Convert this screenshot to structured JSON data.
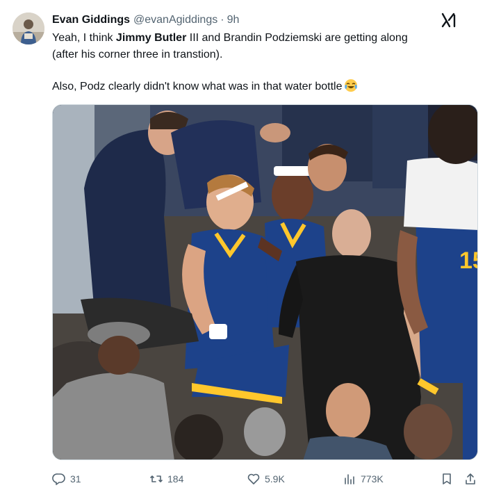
{
  "author": {
    "name": "Evan Giddings",
    "handle": "@evanAgiddings",
    "separator": "·",
    "time": "9h"
  },
  "tweet": {
    "line1_pre": "Yeah, I think ",
    "line1_bold": "Jimmy Butler",
    "line1_post": " III and Brandin Podziemski are getting along",
    "line2": "(after his corner three in transtion).",
    "line3": "Also, Podz clearly didn't know what was in that water bottle",
    "emoji": "face-with-tears-of-joy-icon"
  },
  "media": {
    "jersey_number": "15"
  },
  "actions": {
    "replies": "31",
    "reposts": "184",
    "likes": "5.9K",
    "views": "773K"
  },
  "colors": {
    "text": "#0f1419",
    "muted": "#536471",
    "border": "#cfd9de",
    "warriors_blue": "#1d428a",
    "warriors_gold": "#ffc72c"
  },
  "icons": [
    "grok-icon",
    "reply-icon",
    "repost-icon",
    "like-icon",
    "views-icon",
    "bookmark-icon",
    "share-icon"
  ]
}
